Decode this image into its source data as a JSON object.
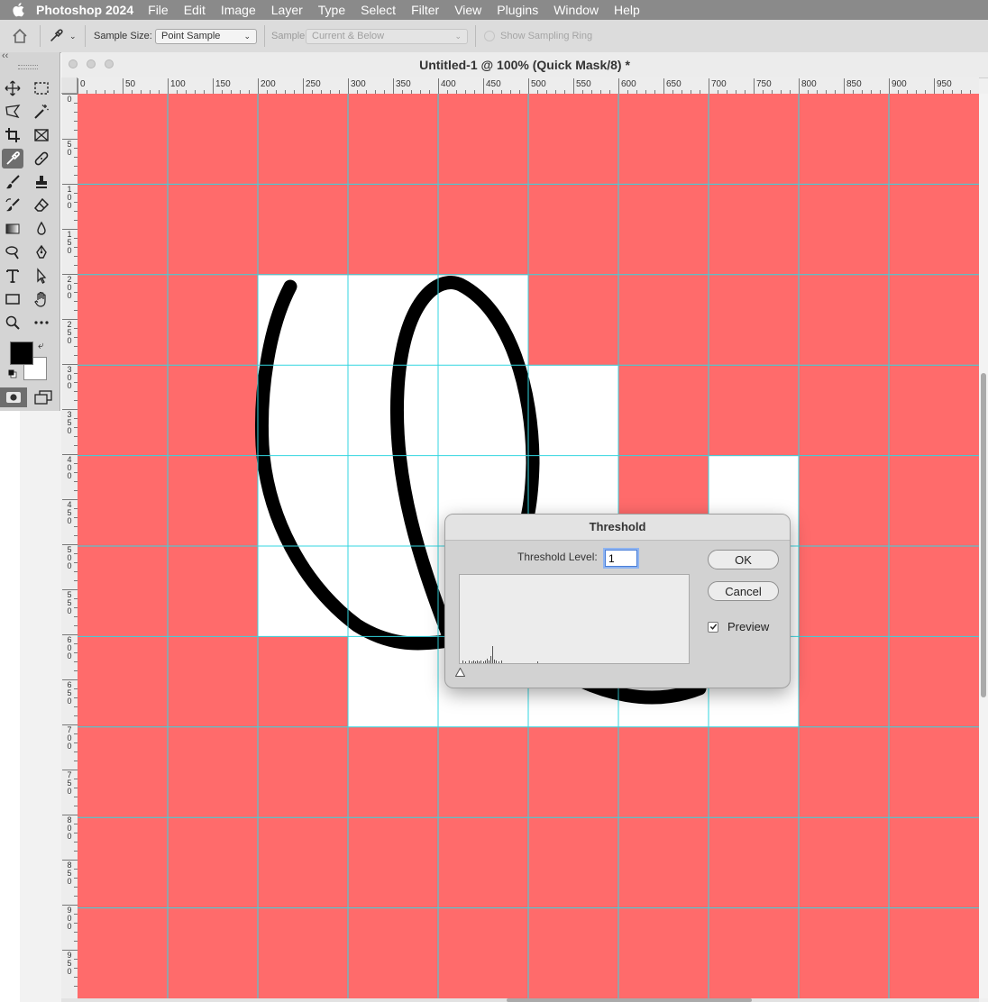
{
  "menubar": {
    "app_name": "Photoshop 2024",
    "items": [
      "File",
      "Edit",
      "Image",
      "Layer",
      "Type",
      "Select",
      "Filter",
      "View",
      "Plugins",
      "Window",
      "Help"
    ]
  },
  "options_bar": {
    "sample_size_label": "Sample Size:",
    "sample_size_value": "Point Sample",
    "sample_label": "Sample:",
    "sample_value": "Current & Below",
    "sampling_ring_label": "Show Sampling Ring"
  },
  "tools": {
    "collapse_glyph": "‹‹",
    "items": [
      {
        "name": "move-tool",
        "icon": "move-icon"
      },
      {
        "name": "marquee-tool",
        "icon": "rect-marquee-icon"
      },
      {
        "name": "lasso-tool",
        "icon": "polygonal-lasso-icon"
      },
      {
        "name": "magic-wand-tool",
        "icon": "magic-wand-icon"
      },
      {
        "name": "crop-tool",
        "icon": "crop-icon"
      },
      {
        "name": "frame-tool",
        "icon": "frame-icon"
      },
      {
        "name": "eyedropper-tool",
        "icon": "eyedropper-icon",
        "active": true
      },
      {
        "name": "healing-tool",
        "icon": "bandage-icon"
      },
      {
        "name": "brush-tool",
        "icon": "brush-icon"
      },
      {
        "name": "stamp-tool",
        "icon": "stamp-icon"
      },
      {
        "name": "history-brush-tool",
        "icon": "history-brush-icon"
      },
      {
        "name": "eraser-tool",
        "icon": "eraser-icon"
      },
      {
        "name": "gradient-tool",
        "icon": "gradient-icon"
      },
      {
        "name": "blur-tool",
        "icon": "drop-icon"
      },
      {
        "name": "dodge-tool",
        "icon": "dodge-icon"
      },
      {
        "name": "pen-tool",
        "icon": "pen-icon"
      },
      {
        "name": "type-tool",
        "icon": "type-icon"
      },
      {
        "name": "path-select-tool",
        "icon": "arrow-icon"
      },
      {
        "name": "rectangle-tool",
        "icon": "rectangle-icon"
      },
      {
        "name": "hand-tool",
        "icon": "hand-icon"
      },
      {
        "name": "zoom-tool",
        "icon": "zoom-icon"
      },
      {
        "name": "more-tools",
        "icon": "ellipsis-icon"
      }
    ],
    "foreground_color": "#000000",
    "background_color": "#ffffff"
  },
  "document": {
    "title": "Untitled-1 @ 100% (Quick Mask/8) *",
    "h_ruler_labels": [
      "0",
      "50",
      "100",
      "150",
      "200",
      "250",
      "300",
      "350",
      "400",
      "450",
      "500",
      "550",
      "600",
      "650",
      "700",
      "750",
      "800",
      "850",
      "900",
      "950"
    ],
    "v_ruler_labels": [
      "0",
      "50",
      "100",
      "150",
      "200",
      "250",
      "300",
      "350",
      "400",
      "450",
      "500",
      "550",
      "600",
      "650",
      "700",
      "750",
      "800",
      "850",
      "900",
      "950"
    ],
    "mask_color": "#ff6b6b",
    "guide_color": "#33d6e0",
    "grid_columns": 10,
    "grid_rows": 10,
    "unmasked_cells": [
      [
        2,
        2
      ],
      [
        2,
        3
      ],
      [
        2,
        4
      ],
      [
        3,
        2
      ],
      [
        3,
        3
      ],
      [
        3,
        4
      ],
      [
        3,
        5
      ],
      [
        4,
        2
      ],
      [
        4,
        3
      ],
      [
        4,
        4
      ],
      [
        4,
        5
      ],
      [
        4,
        7
      ],
      [
        5,
        2
      ],
      [
        5,
        3
      ],
      [
        5,
        4
      ],
      [
        5,
        5
      ],
      [
        5,
        6
      ],
      [
        5,
        7
      ],
      [
        6,
        3
      ],
      [
        6,
        4
      ],
      [
        6,
        5
      ],
      [
        6,
        6
      ],
      [
        6,
        7
      ]
    ]
  },
  "dialog": {
    "title": "Threshold",
    "threshold_label": "Threshold Level:",
    "threshold_value": "1",
    "threshold_fraction": 0.004,
    "ok_label": "OK",
    "cancel_label": "Cancel",
    "preview_label": "Preview",
    "preview_checked": true
  }
}
